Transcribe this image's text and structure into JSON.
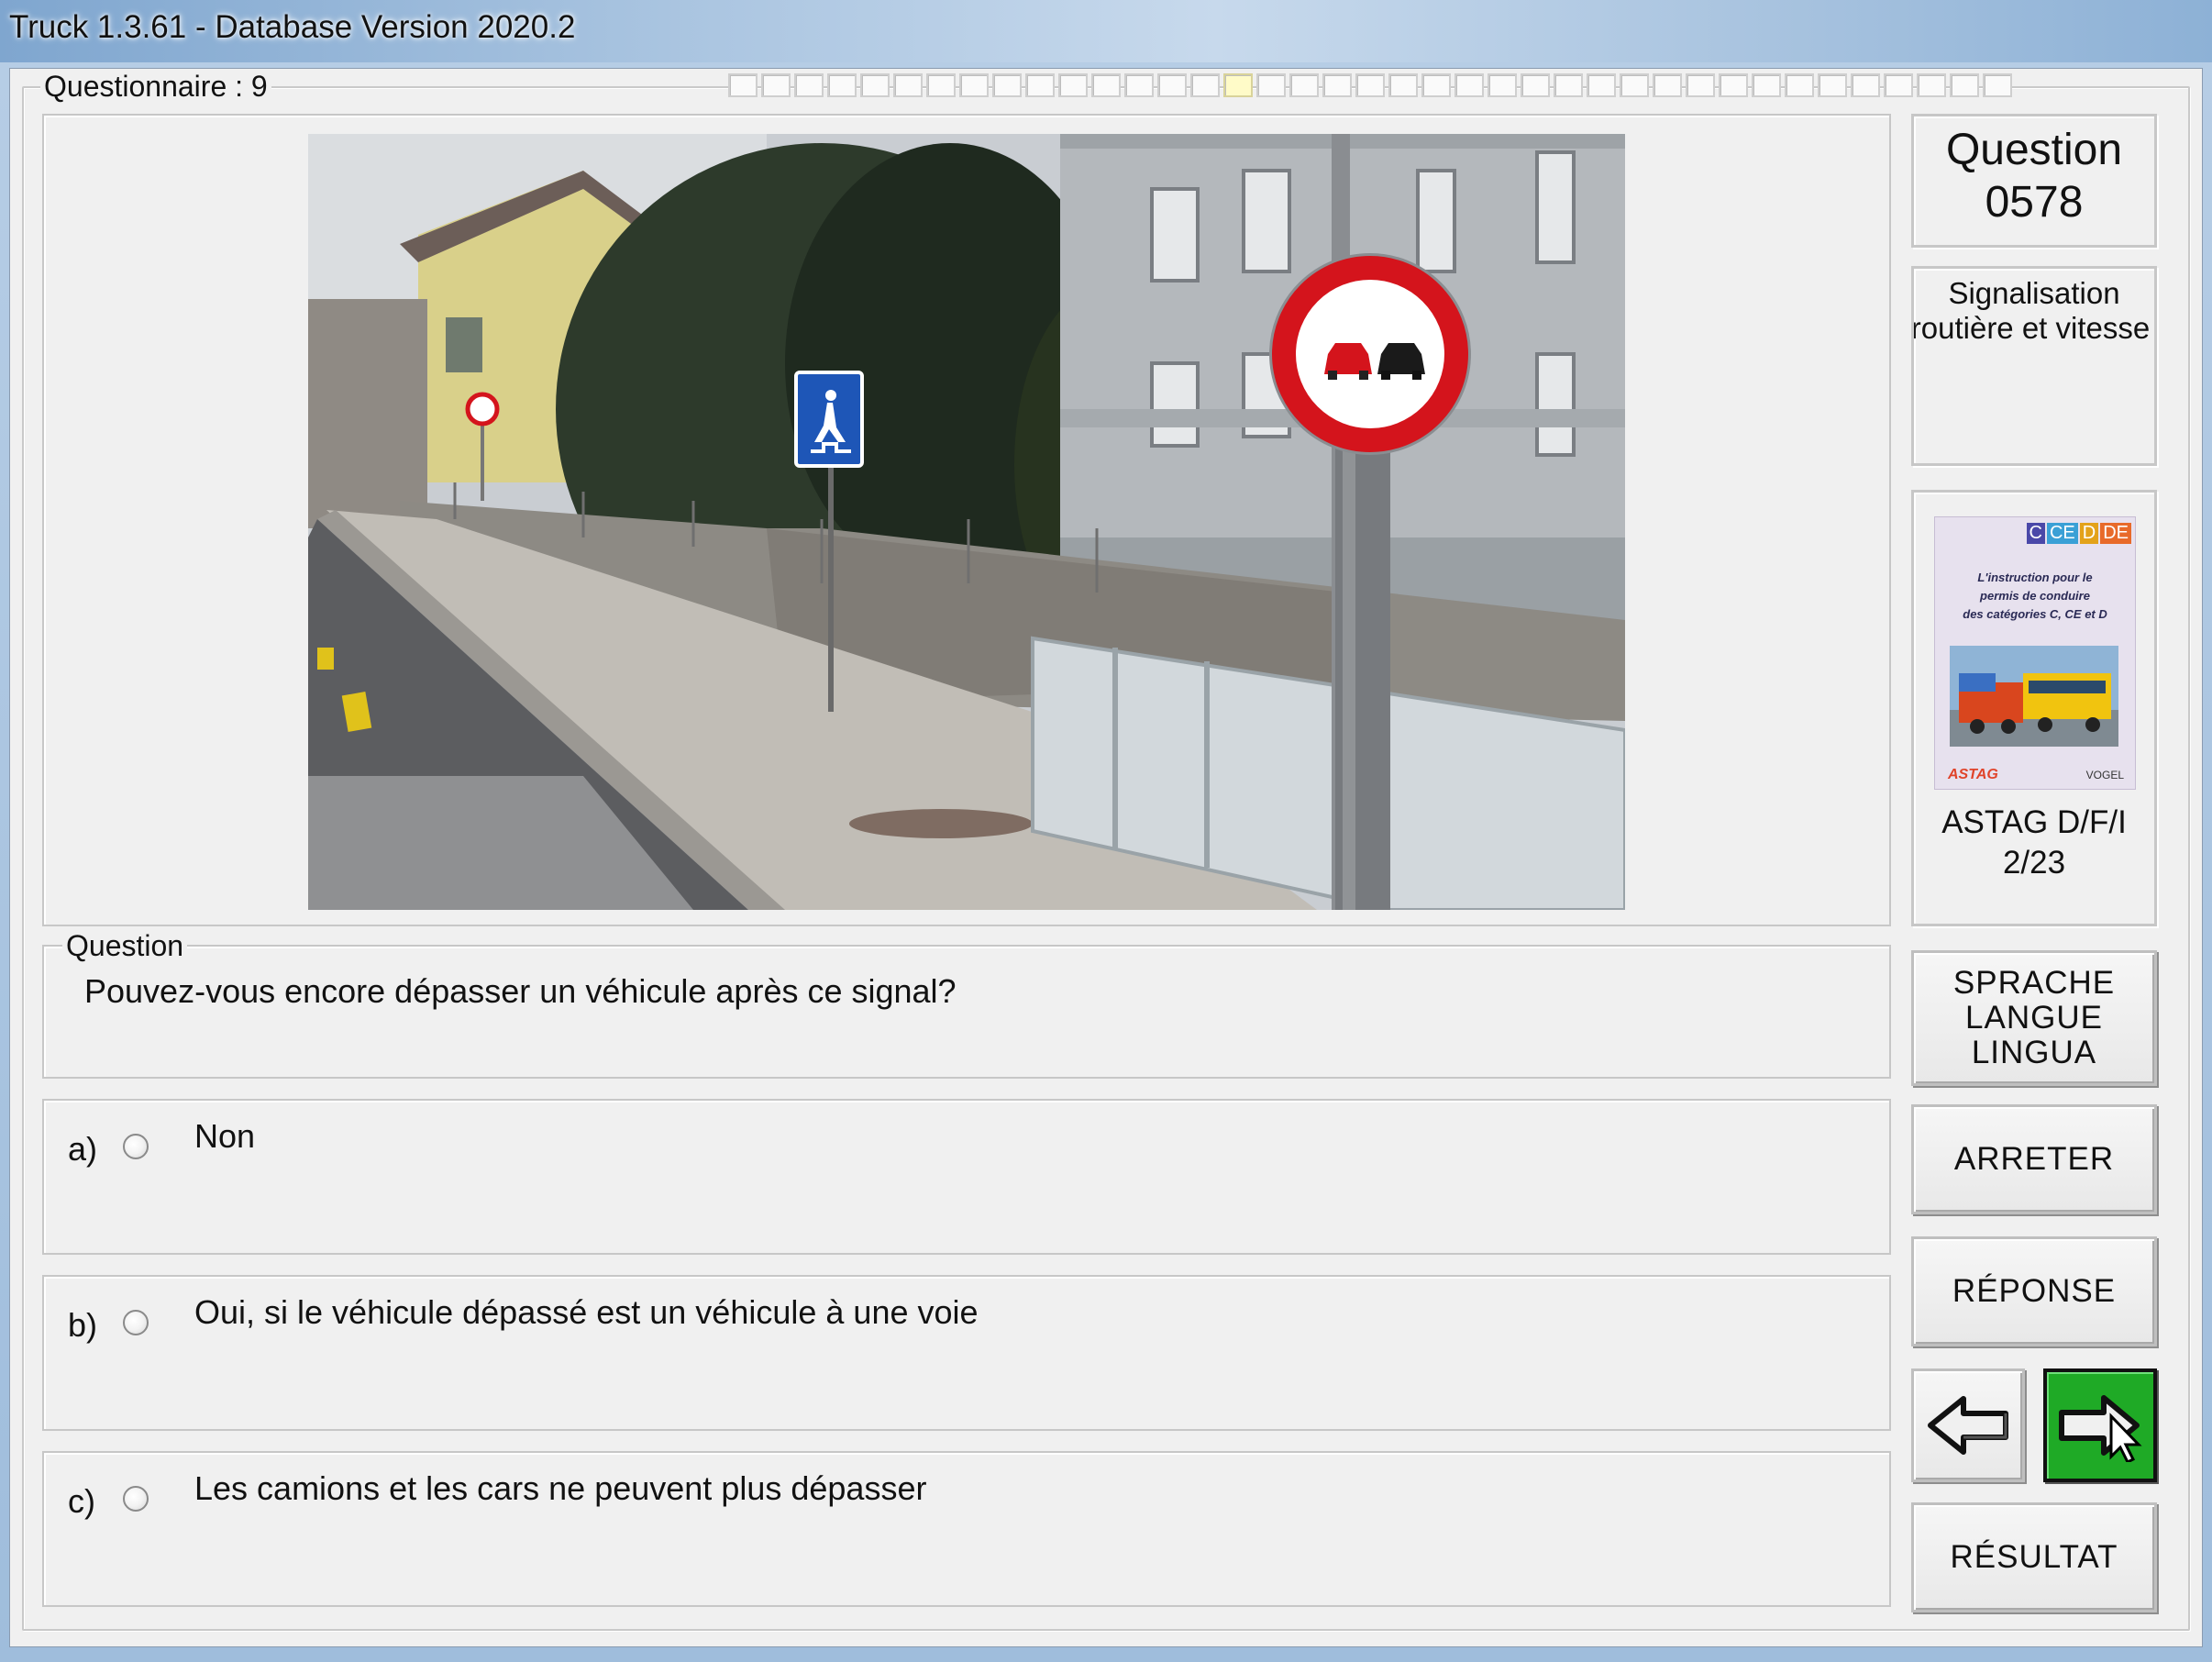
{
  "window": {
    "title": "Truck 1.3.61 - Database Version 2020.2"
  },
  "questionnaire": {
    "label": "Questionnaire : 9",
    "progress_total": 39,
    "progress_current": 16
  },
  "question_box": {
    "label": "Question",
    "text": "Pouvez-vous encore dépasser un véhicule après ce signal?"
  },
  "answers": [
    {
      "letter": "a)",
      "text": "Non"
    },
    {
      "letter": "b)",
      "text": "Oui, si le véhicule dépassé est un véhicule à une voie"
    },
    {
      "letter": "c)",
      "text": "Les camions et les cars ne peuvent plus dépasser"
    }
  ],
  "side": {
    "question_title": "Question",
    "question_number": "0578",
    "category_line1": "Signalisation",
    "category_line2": "routière et vitesse",
    "book_badges": [
      "C",
      "CE",
      "D",
      "DE"
    ],
    "book_cover_line1": "L'instruction pour le",
    "book_cover_line2": "permis de conduire",
    "book_cover_line3": "des catégories C, CE et D",
    "book_logo_left": "ASTAG",
    "book_logo_right": "VOGEL",
    "book_source": "ASTAG D/F/I",
    "book_page": "2/23"
  },
  "buttons": {
    "language_line1": "SPRACHE",
    "language_line2": "LANGUE",
    "language_line3": "LINGUA",
    "stop": "ARRETER",
    "answer": "RÉPONSE",
    "result": "RÉSULTAT"
  },
  "colors": {
    "next_button_green": "#1faa26",
    "sign_red": "#d4141c"
  }
}
